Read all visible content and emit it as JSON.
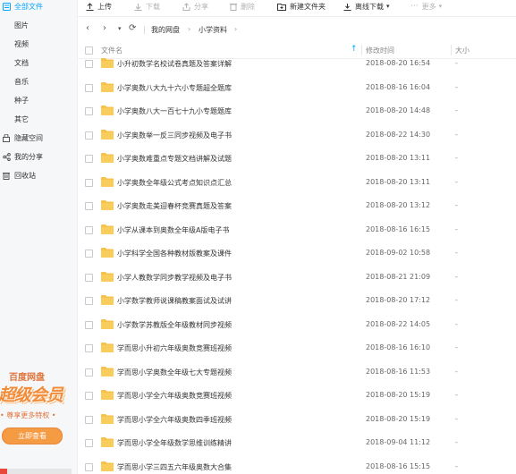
{
  "sidebar": {
    "items": [
      {
        "label": "全部文件",
        "icon": "all-files-icon",
        "active": true
      },
      {
        "label": "图片"
      },
      {
        "label": "视频"
      },
      {
        "label": "文档"
      },
      {
        "label": "音乐"
      },
      {
        "label": "种子"
      },
      {
        "label": "其它"
      },
      {
        "label": "隐藏空间",
        "icon": "lock-icon"
      },
      {
        "label": "我的分享",
        "icon": "share-icon"
      },
      {
        "label": "回收站",
        "icon": "trash-icon"
      }
    ],
    "promo": {
      "brand": "百度网盘",
      "headline": "超级会员",
      "subtitle": "• 尊享更多特权 •",
      "button": "立即查看"
    }
  },
  "toolbar": {
    "upload": "上传",
    "download": "下载",
    "share": "分享",
    "delete": "删除",
    "new_folder": "新建文件夹",
    "offline_download": "离线下载",
    "more": "更多"
  },
  "path": {
    "crumbs": [
      "我的网盘",
      "小学资料"
    ]
  },
  "table": {
    "headers": {
      "name": "文件名",
      "modified": "修改时间",
      "size": "大小"
    },
    "rows": [
      {
        "name": "小升初数学名校试卷真题及答案详解",
        "time": "2018-08-20 16:54",
        "size": "-"
      },
      {
        "name": "小学奥数八大九十六小专题超全题库",
        "time": "2018-08-16 16:04",
        "size": "-"
      },
      {
        "name": "小学奥数八大一百七十九小专题题库",
        "time": "2018-08-20 14:48",
        "size": "-"
      },
      {
        "name": "小学奥数举一反三同步视频及电子书",
        "time": "2018-08-22 14:30",
        "size": "-"
      },
      {
        "name": "小学奥数难重点专题文档讲解及试题",
        "time": "2018-08-20 13:11",
        "size": "-"
      },
      {
        "name": "小学奥数全年级公式考点知识点汇总",
        "time": "2018-08-20 13:11",
        "size": "-"
      },
      {
        "name": "小学奥数走美迎春杯竞赛真题及答案",
        "time": "2018-08-20 13:12",
        "size": "-"
      },
      {
        "name": "小学从课本到奥数全年级A版电子书",
        "time": "2018-08-16 16:15",
        "size": "-"
      },
      {
        "name": "小学科学全国各种教材版教案及课件",
        "time": "2018-09-02 10:58",
        "size": "-"
      },
      {
        "name": "小学人教数学同步教学视频及电子书",
        "time": "2018-08-21 21:09",
        "size": "-"
      },
      {
        "name": "小学数学教师说课稿教案面试及试讲",
        "time": "2018-08-20 17:12",
        "size": "-"
      },
      {
        "name": "小学数学苏教版全年级教材同步视频",
        "time": "2018-08-22 14:05",
        "size": "-"
      },
      {
        "name": "学而思小升初六年级奥数竞赛班视频",
        "time": "2018-08-16 16:10",
        "size": "-"
      },
      {
        "name": "学而思小学奥数全年级七大专题视频",
        "time": "2018-08-16 11:53",
        "size": "-"
      },
      {
        "name": "学而思小学全六年级奥数竞赛班视频",
        "time": "2018-08-20 15:19",
        "size": "-"
      },
      {
        "name": "学而思小学全六年级奥数四季班视频",
        "time": "2018-08-20 15:19",
        "size": "-"
      },
      {
        "name": "学而思小学全年级数学思维训练精讲",
        "time": "2018-09-04 11:12",
        "size": "-"
      },
      {
        "name": "学而思小学三四五六年级奥数大合集",
        "time": "2018-08-16 15:15",
        "size": "-"
      }
    ]
  },
  "colors": {
    "accent": "#06a7ff",
    "folder": "#f7c14a",
    "promo": "#f49b44"
  }
}
